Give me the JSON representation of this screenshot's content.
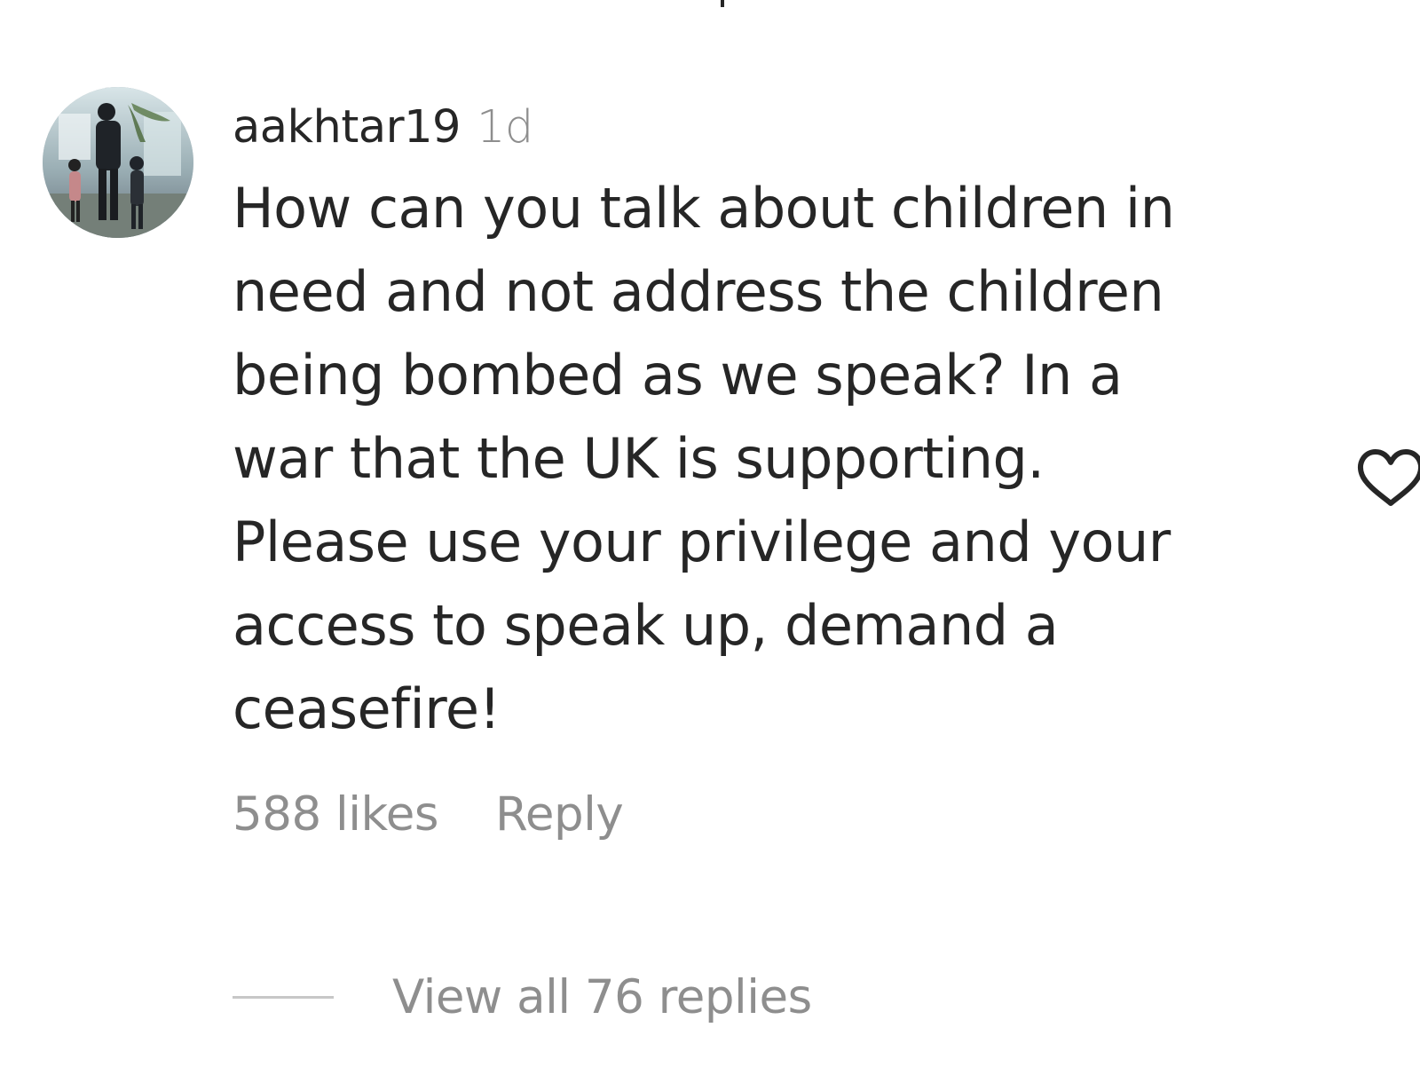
{
  "comment": {
    "username": "aakhtar19",
    "time_ago": "1d",
    "text": "How can you talk about children in\nneed and not address the children\nbeing bombed as we speak? In a\nwar that the UK is supporting.\nPlease use your privilege and your\naccess to speak up, demand a\nceasefire!",
    "likes_label": "588 likes",
    "reply_label": "Reply",
    "view_replies_label": "View all 76 replies",
    "like_icon": "heart-outline-icon"
  },
  "colors": {
    "primary_text": "#262626",
    "secondary_text": "#8e8e8e",
    "divider": "#c7c7c7",
    "background": "#ffffff"
  }
}
